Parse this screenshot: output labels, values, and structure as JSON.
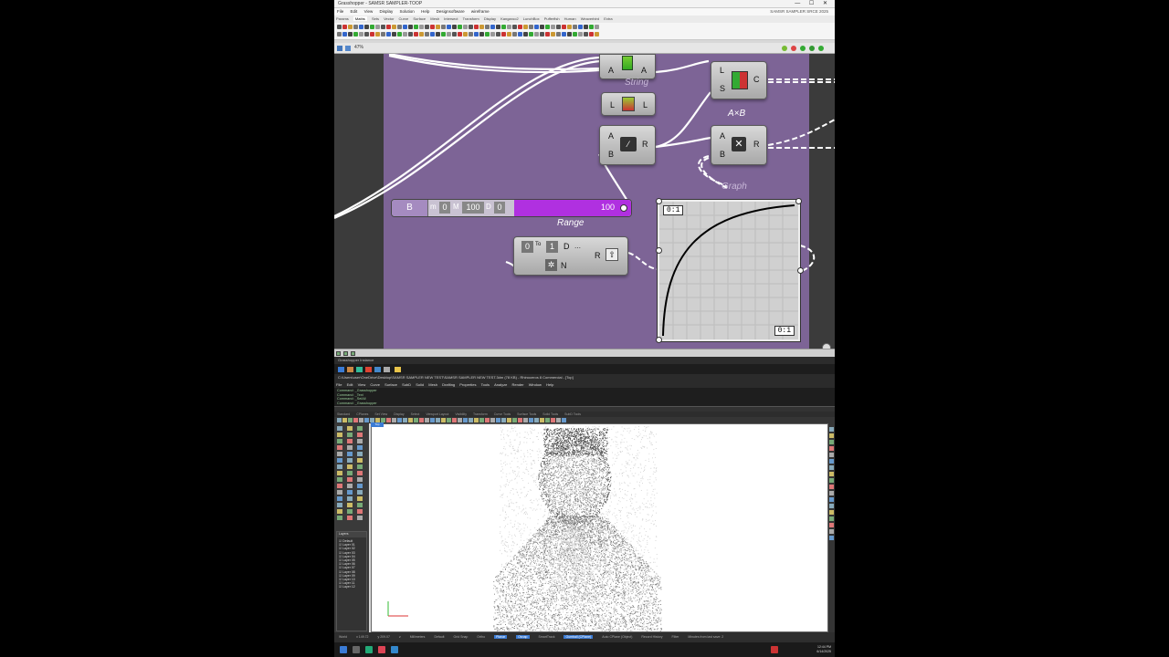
{
  "colors": {
    "canvas_bg": "#3b3b3b",
    "group_fill": "#7d6496",
    "slider_fill": "#b030e0",
    "wire": "#ffffff",
    "rhino_dark": "#2b2b2b",
    "viewport_bg": "#ffffff",
    "accent_blue": "#3b7bd4"
  },
  "gh": {
    "title": "Grasshopper - SAMSR SAMPLER-TOOP",
    "window_controls": "— ☐ ✕",
    "menu": [
      "File",
      "Edit",
      "View",
      "Display",
      "Solution",
      "Help",
      "Designsoftware",
      "wireframe"
    ],
    "menu_right": "SAMSR SAMPLER SRCE 2025",
    "tabs": [
      "Params",
      "Maths",
      "Sets",
      "Vector",
      "Curve",
      "Surface",
      "Mesh",
      "Intersect",
      "Transform",
      "Display",
      "Kangaroo2",
      "LunchBox",
      "Pufferfish",
      "Human",
      "Weaverbird",
      "Extra"
    ],
    "active_tab": "Maths",
    "zoom": "47%",
    "components": {
      "list_item": {
        "in": "L",
        "out": "L"
      },
      "equality": {
        "a": "A",
        "out": "A"
      },
      "division": {
        "a": "A",
        "b": "B",
        "out": "R"
      },
      "pick": {
        "l": "L",
        "s": "S",
        "out": "C"
      },
      "multiply": {
        "a": "A",
        "b": "B",
        "out": "R"
      },
      "multiply_label": "A×B",
      "graph_label": "Graph",
      "string_label": "String",
      "range": {
        "domain": "D",
        "steps": "N",
        "out": "R",
        "from": "0",
        "to": "1",
        "label": "Range"
      }
    },
    "slider": {
      "name": "B",
      "min_label": "m",
      "min": "0",
      "max_label": "M",
      "max": "100",
      "decimals_label": "D",
      "decimals": "0",
      "value": "100",
      "fill_fraction": 1.0
    },
    "graph": {
      "top_label": "0:1",
      "bottom_label": "0:1"
    }
  },
  "sep": {
    "text": "Grasshopper Instance"
  },
  "rhino": {
    "title": "C:\\Users\\user\\OneDrive\\Desktop\\SAMSR SAMPLER NEW TEST\\SAMSR SAMPLER NEW TEST.3dm (78 KB) - Rhinoceros 8 Commercial - [Top]",
    "menu": [
      "File",
      "Edit",
      "View",
      "Curve",
      "Surface",
      "SubD",
      "Solid",
      "Mesh",
      "Drafting",
      "Properties",
      "Tools",
      "Analyze",
      "Render",
      "Window",
      "Help"
    ],
    "cmd_lines": [
      "Command: _Grasshopper",
      "Command: _Text",
      "Command: _SelAll",
      "Command: _Grasshopper",
      "Command:"
    ],
    "tabs": [
      "Standard",
      "CPlanes",
      "Set View",
      "Display",
      "Select",
      "Viewport Layout",
      "Visibility",
      "Transform",
      "Curve Tools",
      "Surface Tools",
      "Solid Tools",
      "SubD Tools",
      "Mesh Tools",
      "Render Tools",
      "Drafting"
    ],
    "viewport_tab": "Top",
    "layers_title": "Layers",
    "layers": [
      "Default",
      "Layer 01",
      "Layer 02",
      "Layer 03",
      "Layer 04",
      "Layer 05",
      "Layer 06",
      "Layer 07",
      "Layer 08",
      "Layer 09",
      "Layer 10",
      "Layer 11",
      "Layer 12"
    ],
    "status": [
      "World",
      "x 149.72",
      "y 209.07",
      "z",
      "Millimeters",
      "Default",
      "Grid Snap",
      "Ortho",
      "Planar",
      "Osnap",
      "SmartTrack",
      "Gumball (CPlane)",
      "Auto CPlane (Object)",
      "Record History",
      "Filter",
      "Minutes from last save: 2"
    ],
    "status_on": [
      "Planar",
      "Osnap",
      "Gumball (CPlane)"
    ],
    "clock_time": "12:44 PM",
    "clock_date": "6/14/2025"
  }
}
